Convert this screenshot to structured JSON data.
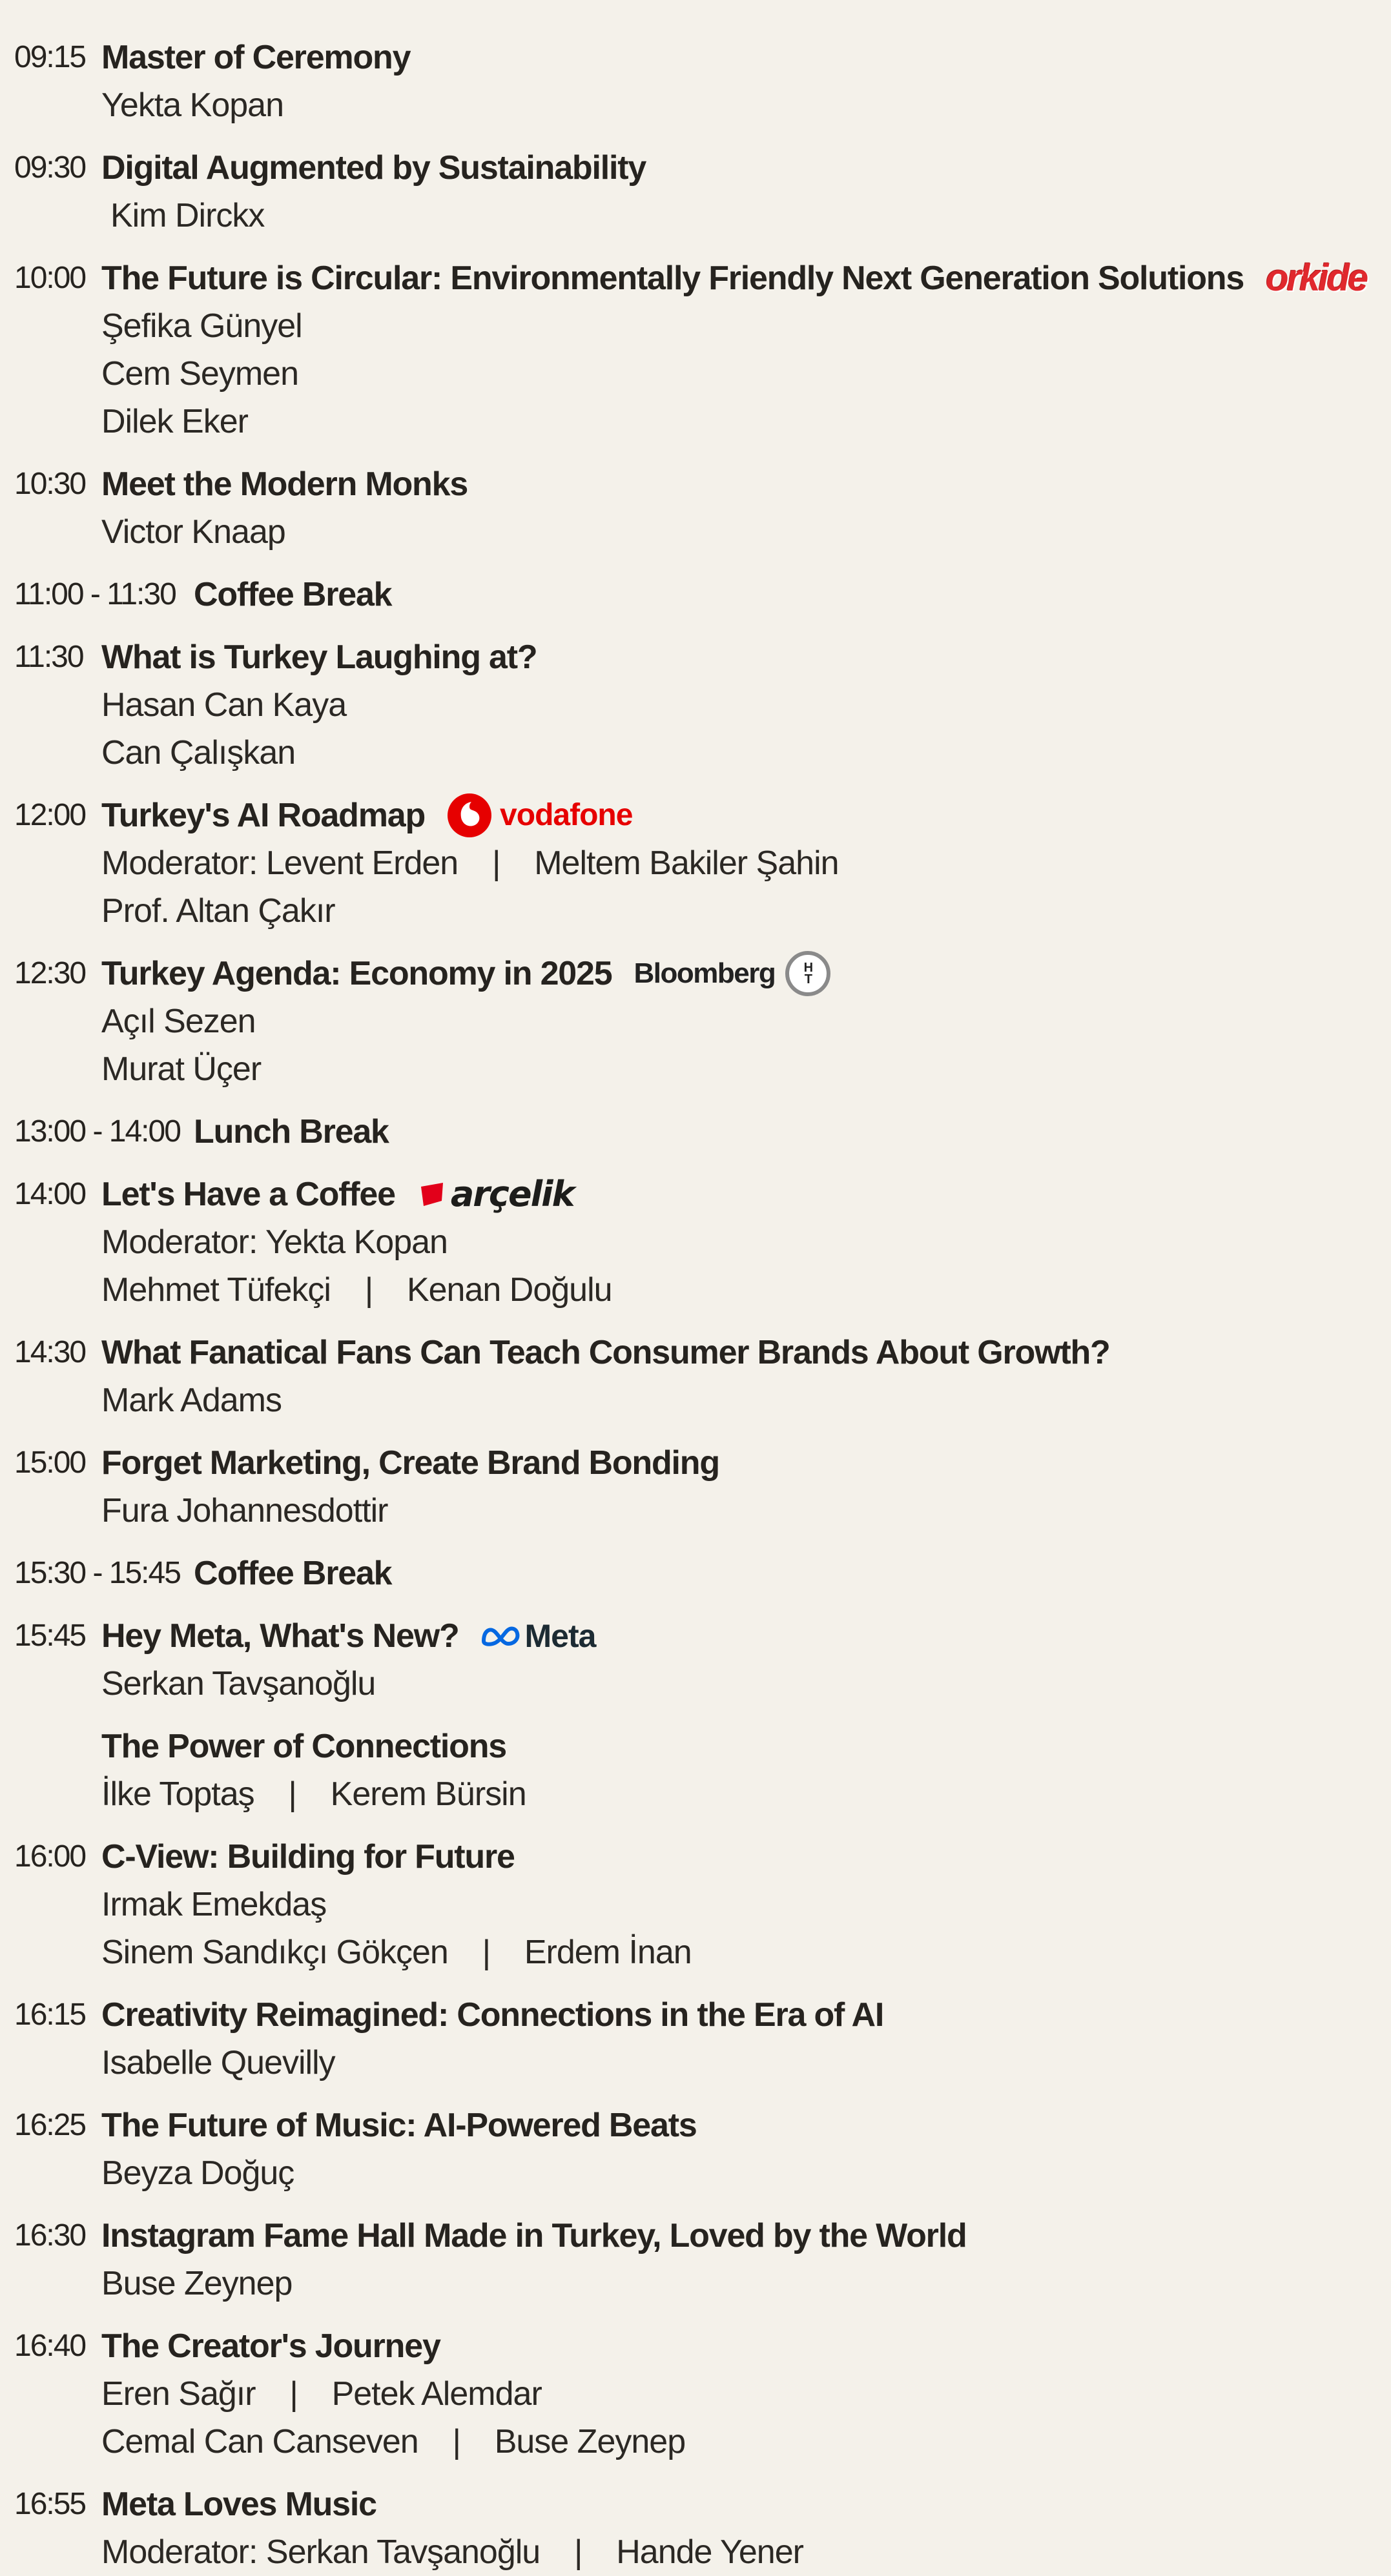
{
  "sessions": [
    {
      "time": "09:15",
      "title": "Master of Ceremony",
      "speakers": [
        "Yekta Kopan"
      ]
    },
    {
      "time": "09:30",
      "title": "Digital Augmented by Sustainability",
      "speakers": [
        "Kim Dirckx"
      ]
    },
    {
      "time": "10:00",
      "title": "The Future is Circular: Environmentally Friendly Next Generation Solutions",
      "logo": "orkide",
      "speakers": [
        "Şefika Günyel",
        "Cem Seymen",
        "Dilek Eker"
      ]
    },
    {
      "time": "10:30",
      "title": "Meet the Modern Monks",
      "speakers": [
        "Victor Knaap"
      ]
    },
    {
      "time": "11:00 - 11:30",
      "title": "Coffee Break",
      "break": true
    },
    {
      "time": "11:30",
      "title": "What is Turkey Laughing at?",
      "speakers": [
        "Hasan Can Kaya",
        "Can Çalışkan"
      ]
    },
    {
      "time": "12:00",
      "title": "Turkey's AI Roadmap",
      "logo": "vodafone",
      "speakers": [
        "Moderator: Levent Erden",
        "Meltem Bakiler Şahin",
        "Prof. Altan Çakır"
      ]
    },
    {
      "time": "12:30",
      "title": "Turkey Agenda: Economy in 2025",
      "logo": "Bloomberg",
      "speakers": [
        "Açıl Sezen",
        "Murat Üçer"
      ]
    },
    {
      "time": "13:00 - 14:00",
      "title": "Lunch Break",
      "break": true
    },
    {
      "time": "14:00",
      "title": "Let's Have a Coffee",
      "logo": "arçelik",
      "speakers": [
        "Moderator: Yekta Kopan",
        "Mehmet Tüfekçi",
        "Kenan Doğulu"
      ]
    },
    {
      "time": "14:30",
      "title": "What Fanatical Fans Can Teach Consumer Brands About Growth?",
      "speakers": [
        "Mark Adams"
      ]
    },
    {
      "time": "15:00",
      "title": "Forget Marketing, Create Brand Bonding",
      "speakers": [
        "Fura Johannesdottir"
      ]
    },
    {
      "time": "15:30 - 15:45",
      "title": "Coffee Break",
      "break": true
    },
    {
      "time": "15:45",
      "title": "Hey Meta, What's New?",
      "logo": "Meta",
      "speakers": [
        "Serkan Tavşanoğlu"
      ]
    },
    {
      "time": "",
      "title": "The Power of Connections",
      "speakers": [
        "İlke Toptaş",
        "Kerem Bürsin"
      ]
    },
    {
      "time": "16:00",
      "title": "C-View: Building for Future",
      "speakers": [
        "Irmak Emekdaş",
        "Sinem Sandıkçı Gökçen",
        "Erdem İnan"
      ]
    },
    {
      "time": "16:15",
      "title": "Creativity Reimagined: Connections in the Era of AI",
      "speakers": [
        "Isabelle Quevilly"
      ]
    },
    {
      "time": "16:25",
      "title": "The Future of Music: AI-Powered Beats",
      "speakers": [
        "Beyza Doğuç"
      ]
    },
    {
      "time": "16:30",
      "title": "Instagram Fame Hall Made in Turkey, Loved by the World",
      "speakers": [
        "Buse Zeynep"
      ]
    },
    {
      "time": "16:40",
      "title": "The Creator's Journey",
      "speakers": [
        "Eren Sağır",
        "Petek Alemdar",
        "Cemal Can Canseven",
        "Buse Zeynep"
      ]
    },
    {
      "time": "16:55",
      "title": "Meta Loves Music",
      "speakers": [
        "Moderator: Serkan Tavşanoğlu",
        "Hande Yener"
      ]
    }
  ],
  "separator": "|",
  "logos": {
    "orkide": "orkide",
    "vodafone": "vodafone",
    "bloomberg": "Bloomberg",
    "ht_top": "H",
    "ht_bottom": "T",
    "arcelik": "arçelik",
    "meta": "Meta"
  }
}
